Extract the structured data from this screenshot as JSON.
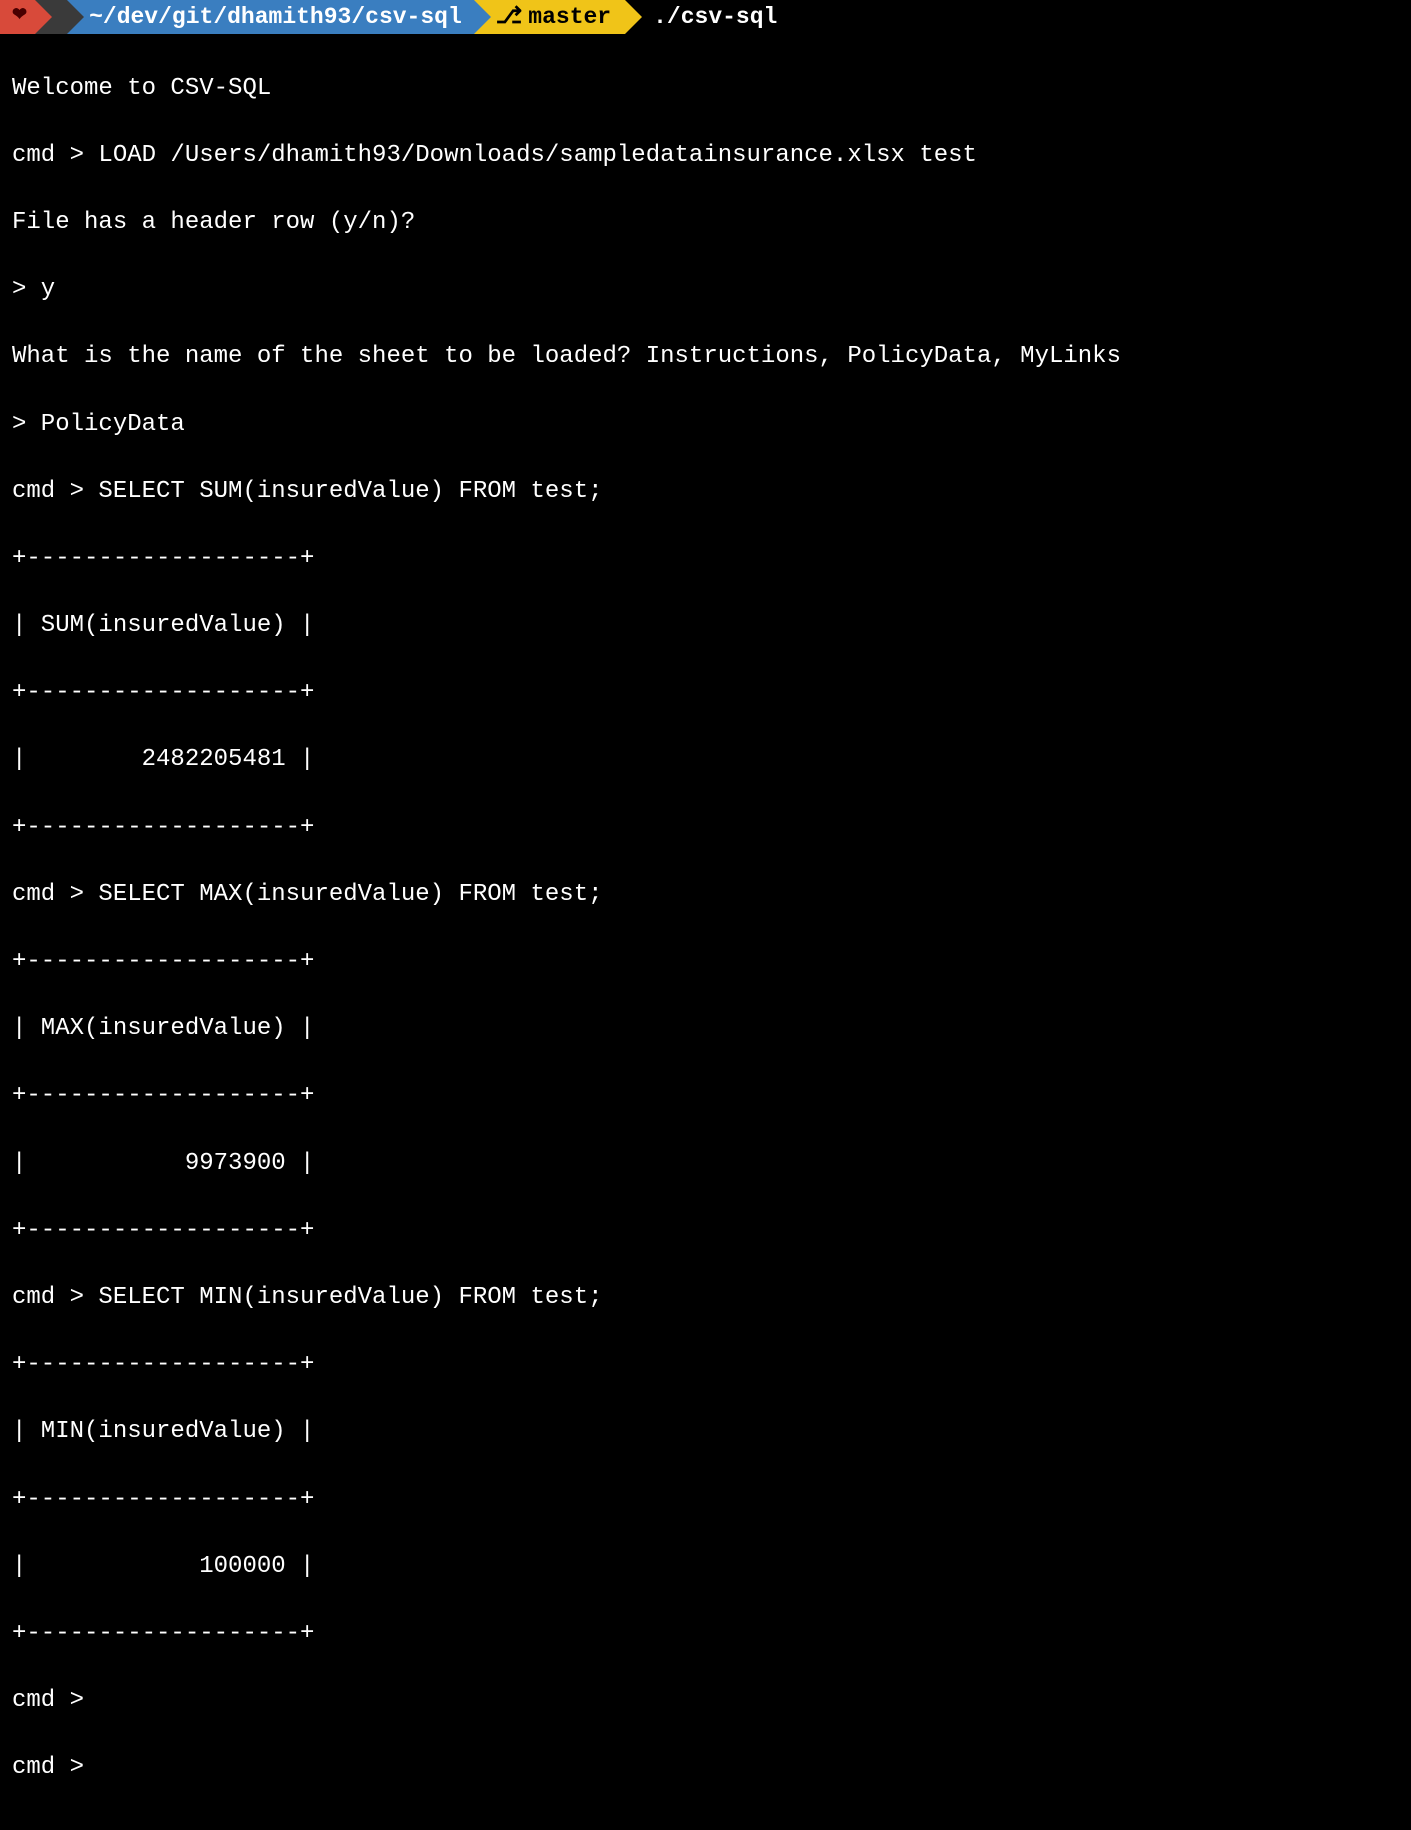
{
  "prompt": {
    "heart_icon": "❤",
    "apple_icon": "",
    "path": "~/dev/git/dhamith93/csv-sql",
    "branch_icon": "⎇",
    "branch": "master",
    "command": "./csv-sql"
  },
  "session": {
    "welcome": "Welcome to CSV-SQL",
    "load_cmd": "cmd > LOAD /Users/dhamith93/Downloads/sampledatainsurance.xlsx test",
    "header_prompt": "File has a header row (y/n)?",
    "header_answer": "> y",
    "sheet_prompt": "What is the name of the sheet to be loaded? Instructions, PolicyData, MyLinks",
    "sheet_answer": "> PolicyData",
    "queries": [
      {
        "cmd": "cmd > SELECT SUM(insuredValue) FROM test;",
        "sep": "+-------------------+",
        "header": "| SUM(insuredValue) |",
        "row": "|        2482205481 |"
      },
      {
        "cmd": "cmd > SELECT MAX(insuredValue) FROM test;",
        "sep": "+-------------------+",
        "header": "| MAX(insuredValue) |",
        "row": "|           9973900 |"
      },
      {
        "cmd": "cmd > SELECT MIN(insuredValue) FROM test;",
        "sep": "+-------------------+",
        "header": "| MIN(insuredValue) |",
        "row": "|            100000 |"
      }
    ],
    "empty_prompt1": "cmd >",
    "empty_prompt2": "cmd >"
  }
}
